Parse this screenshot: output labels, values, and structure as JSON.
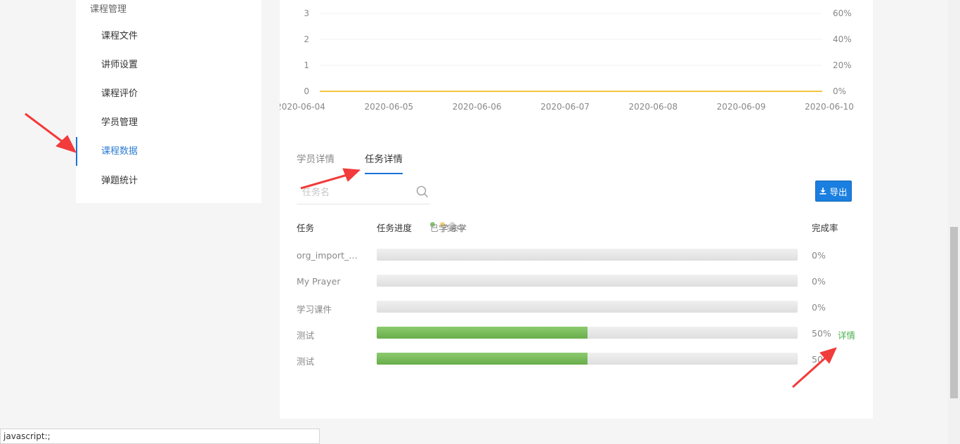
{
  "sidebar": {
    "group_title": "课程管理",
    "items": [
      {
        "label": "课程文件"
      },
      {
        "label": "讲师设置"
      },
      {
        "label": "课程评价"
      },
      {
        "label": "学员管理"
      },
      {
        "label": "课程数据"
      },
      {
        "label": "弹题统计"
      }
    ],
    "active_index": 4
  },
  "chart_data": {
    "type": "line",
    "x": [
      "2020-06-04",
      "2020-06-05",
      "2020-06-06",
      "2020-06-07",
      "2020-06-08",
      "2020-06-09",
      "2020-06-10"
    ],
    "y_left_ticks": [
      "0",
      "1",
      "2",
      "3"
    ],
    "y_right_ticks": [
      "0%",
      "20%",
      "40%",
      "60%"
    ],
    "ylim_left": [
      0,
      3
    ],
    "ylim_right": [
      0,
      60
    ],
    "grid": true,
    "series": [
      {
        "values": [
          0,
          0,
          0,
          0,
          0,
          0,
          0
        ],
        "color": "#f5c542",
        "axis": "left"
      }
    ]
  },
  "tabs": [
    {
      "label": "学员详情",
      "active": false
    },
    {
      "label": "任务详情",
      "active": true
    }
  ],
  "search": {
    "placeholder": "任务名",
    "value": ""
  },
  "export_label": "导出",
  "table": {
    "col_task": "任务",
    "col_progress": "任务进度",
    "col_rate": "完成率",
    "legend": [
      {
        "label": "已学完",
        "color": "#8bc56f"
      },
      {
        "label": "学习中",
        "color": "#f7d17c"
      },
      {
        "label": "未学",
        "color": "#d4d4d4"
      }
    ],
    "rows": [
      {
        "name": "org_import_e...",
        "progress": 0,
        "rate": "0%",
        "detail": ""
      },
      {
        "name": "My Prayer",
        "progress": 0,
        "rate": "0%",
        "detail": ""
      },
      {
        "name": "学习课件",
        "progress": 0,
        "rate": "0%",
        "detail": ""
      },
      {
        "name": "测试",
        "progress": 50,
        "rate": "50%",
        "detail": "详情"
      },
      {
        "name": "测试",
        "progress": 50,
        "rate": "50",
        "detail": ""
      }
    ]
  },
  "status_bar": "javascript:;",
  "colors": {
    "accent": "#1a7fe0",
    "progress_fill": "#76b85a",
    "detail_link": "#4caf50"
  }
}
